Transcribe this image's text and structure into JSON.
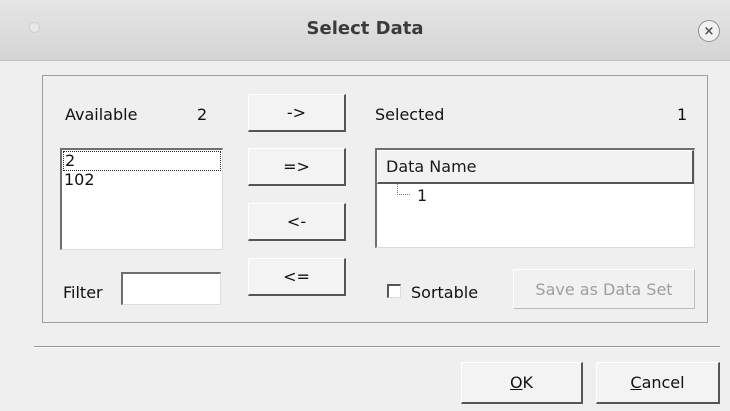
{
  "window": {
    "title": "Select Data",
    "close_symbol": "×"
  },
  "available": {
    "label": "Available",
    "count": "2",
    "items": [
      "2",
      "102"
    ],
    "selected_index": 0
  },
  "transfer_buttons": {
    "move_one_right": "->",
    "move_all_right": "=>",
    "move_one_left": "<-",
    "move_all_left": "<="
  },
  "selected": {
    "label": "Selected",
    "count": "1",
    "column_header": "Data Name",
    "items": [
      "1"
    ]
  },
  "filter": {
    "label": "Filter",
    "value": ""
  },
  "sortable": {
    "label": "Sortable",
    "checked": false
  },
  "save_as_data_set": {
    "label": "Save as Data Set",
    "enabled": false
  },
  "footer": {
    "ok_label": "OK",
    "cancel_label": "Cancel"
  },
  "icons": {
    "close": "close-icon",
    "window_menu": "window-menu-dot-icon",
    "tree_connector": "tree-branch-icon"
  }
}
